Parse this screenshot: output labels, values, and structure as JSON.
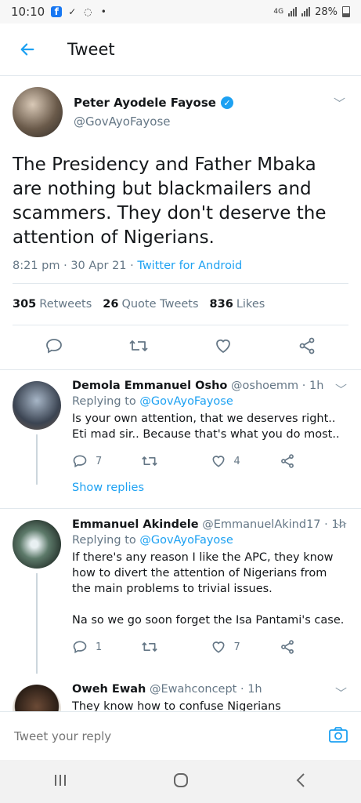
{
  "status": {
    "time": "10:10",
    "network": "4G",
    "battery": "28%"
  },
  "header": {
    "title": "Tweet"
  },
  "tweet": {
    "name": "Peter Ayodele Fayose",
    "handle": "@GovAyoFayose",
    "text": "The Presidency and Father Mbaka are nothing but blackmailers and scammers. They don't deserve the attention of Nigerians.",
    "time": "8:21 pm · 30 Apr 21 · ",
    "source": "Twitter for Android",
    "stats": {
      "retweets_count": "305",
      "retweets_label": "Retweets",
      "quotes_count": "26",
      "quotes_label": "Quote Tweets",
      "likes_count": "836",
      "likes_label": "Likes"
    }
  },
  "replies": [
    {
      "name": "Demola Emmanuel Osho",
      "handle": "@oshoemm",
      "time": " · 1h",
      "replying_label": "Replying to ",
      "replying_to": "@GovAyoFayose",
      "text": "Is your own attention, that we deserves right.. Eti mad sir.. Because that's what you do most..",
      "reply_count": "7",
      "retweet_count": "",
      "like_count": "4"
    },
    {
      "name": "Emmanuel Akindele",
      "handle": "@EmmanuelAkind17",
      "time": " · 1h",
      "replying_label": "Replying to ",
      "replying_to": "@GovAyoFayose",
      "text": "If there's any reason I like the APC, they know how to divert the attention of Nigerians from the main problems to trivial issues.\n\nNa so we go soon forget the Isa Pantami's case.",
      "reply_count": "1",
      "retweet_count": "",
      "like_count": "7"
    },
    {
      "name": "Oweh Ewah",
      "handle": "@Ewahconcept",
      "time": " · 1h",
      "text": "They know how to confuse Nigerians"
    }
  ],
  "show_replies": "Show replies",
  "compose": {
    "placeholder": "Tweet your reply"
  },
  "colors": {
    "accent": "#1da1f2",
    "muted": "#657786",
    "divider": "#e1e8ed"
  }
}
